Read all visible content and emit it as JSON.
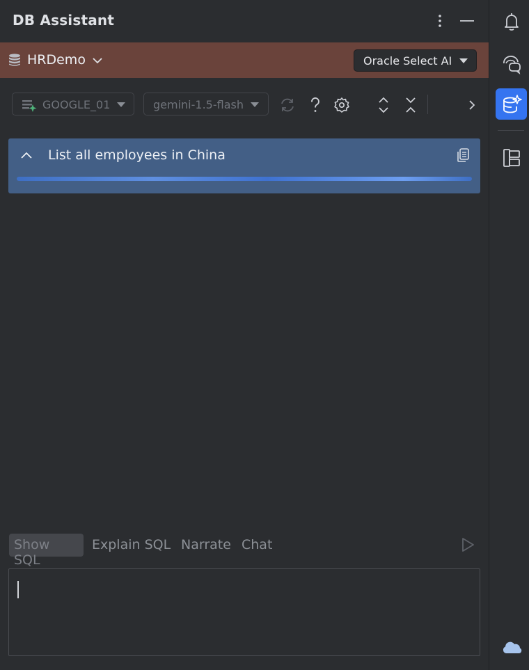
{
  "header": {
    "title": "DB Assistant"
  },
  "connection": {
    "name": "HRDemo",
    "mode": "Oracle Select AI",
    "bar_color": "#6a433b"
  },
  "toolbar": {
    "provider": "GOOGLE_01",
    "model": "gemini-1.5-flash"
  },
  "query": {
    "title": "List all employees in China",
    "card_color": "#435f86"
  },
  "tabs": [
    {
      "label": "Show SQL",
      "selected": true
    },
    {
      "label": "Explain SQL",
      "selected": false
    },
    {
      "label": "Narrate",
      "selected": false
    },
    {
      "label": "Chat",
      "selected": false
    }
  ],
  "prompt": {
    "value": ""
  },
  "rail": {
    "icons": [
      "bell-icon",
      "chat-icon",
      "db-ai-icon",
      "structure-icon",
      "cloud-icon"
    ],
    "active": "db-ai-icon",
    "accent": "#3574f0"
  },
  "icons": {
    "toolbar": [
      "refresh-icon",
      "help-icon",
      "settings-icon",
      "expand-all-icon",
      "collapse-all-icon",
      "chevron-right-icon"
    ]
  }
}
